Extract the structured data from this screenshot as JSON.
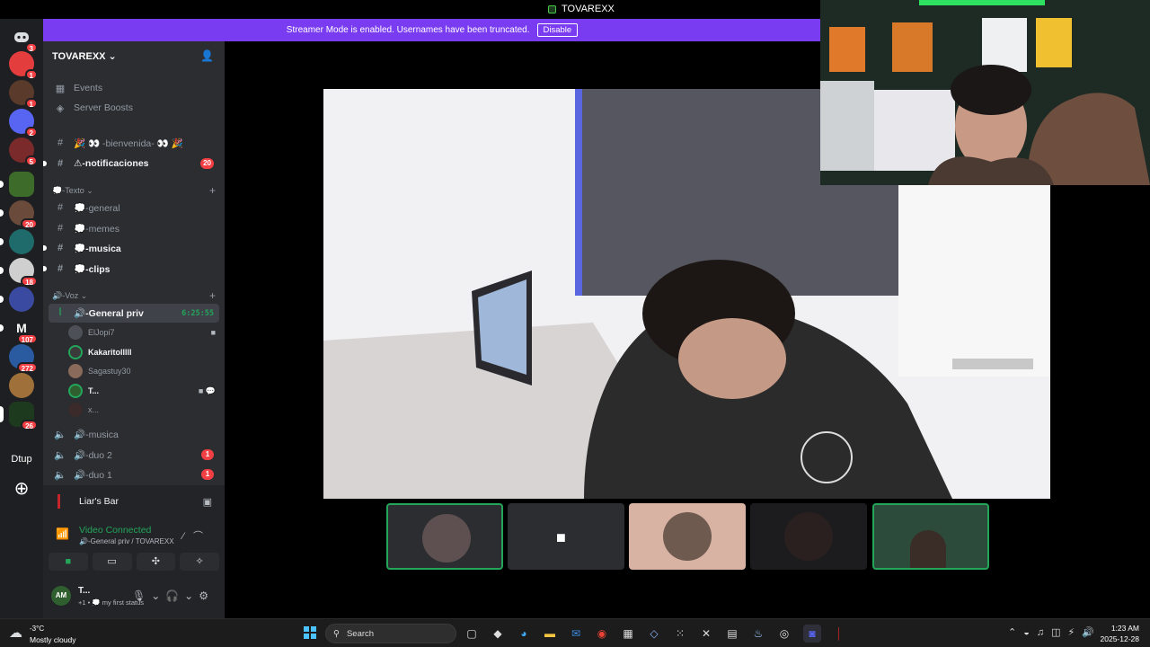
{
  "window": {
    "title": "TOVAREXX"
  },
  "banner": {
    "message": "Streamer Mode is enabled. Usernames have been truncated.",
    "disable_label": "Disable"
  },
  "rail": {
    "badges": [
      "3",
      "1",
      "1",
      "2",
      "5",
      "20",
      "18",
      "107",
      "272",
      "26"
    ],
    "server_label": "Dtup"
  },
  "server": {
    "name": "TOVAREXX",
    "menu": [
      "Events",
      "Server Boosts"
    ],
    "pinned": [
      {
        "name": "🎉 👀 -bienvenida- 👀 🎉"
      },
      {
        "name": "⚠-notificaciones",
        "badge": "20"
      }
    ],
    "text_category": "💭-Texto",
    "text_channels": [
      "💭-general",
      "💭-memes",
      "💭-musica",
      "💭-clips"
    ],
    "voice_category": "🔊-Voz",
    "active_voice": {
      "name": "🔊-General priv",
      "timer": "6:25:55"
    },
    "voice_users": [
      "ElJopi7",
      "Kakaritolllll",
      "Sagastuy30",
      "T...",
      "x..."
    ],
    "voice_channels": [
      {
        "name": "🔊-musica"
      },
      {
        "name": "🔊-duo 2",
        "badge": "1"
      },
      {
        "name": "🔊-duo 1",
        "badge": "1"
      }
    ]
  },
  "activity": {
    "game": "Liar's Bar"
  },
  "voice_status": {
    "status": "Video Connected",
    "channel": "🔊-General priv / TOVAREXX"
  },
  "me": {
    "name": "T...",
    "status": "+1 • 💭 my first status"
  },
  "taskbar": {
    "weather_temp": "-3°C",
    "weather_desc": "Mostly cloudy",
    "search_label": "Search",
    "time": "1:23 AM",
    "date": "2025-12-28"
  },
  "colors": {
    "banner": "#7a3cf0",
    "online_green": "#23a55a",
    "badge_red": "#f23f43",
    "sidebar": "#2b2d31",
    "rail": "#1e1f22"
  }
}
